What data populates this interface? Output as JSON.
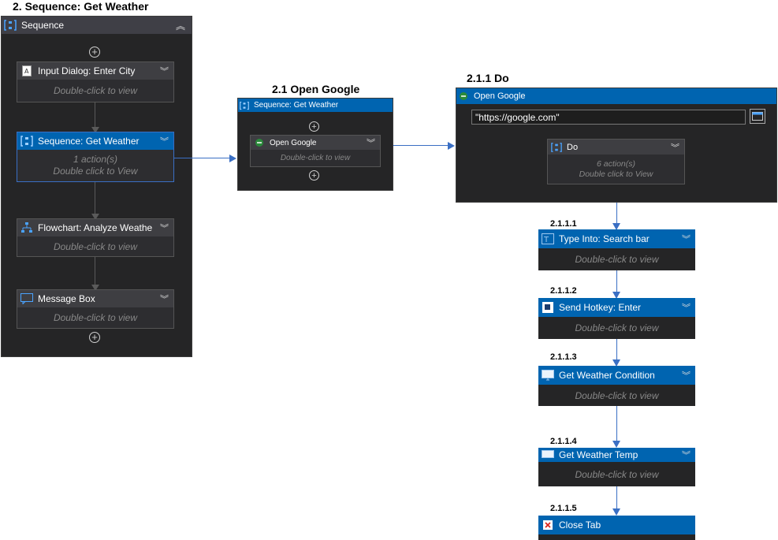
{
  "titles": {
    "main": "2. Sequence: Get Weather",
    "open_google": "2.1 Open Google",
    "do": "2.1.1 Do"
  },
  "main_sequence": {
    "header": "Sequence",
    "activities": [
      {
        "label": "Input Dialog: Enter City",
        "body": "Double-click to view"
      },
      {
        "label": "Sequence: Get Weather",
        "body_line1": "1 action(s)",
        "body_line2": "Double click to View"
      },
      {
        "label": "Flowchart: Analyze Weathe",
        "body": "Double-click to view"
      },
      {
        "label": "Message Box",
        "body": "Double-click to view"
      }
    ]
  },
  "open_google_seq": {
    "header": "Sequence: Get Weather",
    "activity_label": "Open Google",
    "activity_body": "Double-click to view"
  },
  "do_panel": {
    "header": "Open Google",
    "url": "\"https://google.com\"",
    "do_label": "Do",
    "do_line1": "6 action(s)",
    "do_line2": "Double click to View"
  },
  "steps": [
    {
      "number": "2.1.1.1",
      "label": "Type Into: Search bar",
      "body": "Double-click to view"
    },
    {
      "number": "2.1.1.2",
      "label": "Send Hotkey: Enter",
      "body": "Double-click to view"
    },
    {
      "number": "2.1.1.3",
      "label": "Get Weather Condition",
      "body": "Double-click to view"
    },
    {
      "number": "2.1.1.4",
      "label": "Get Weather Temp",
      "body": "Double-click to view"
    },
    {
      "number": "2.1.1.5",
      "label": "Close Tab"
    }
  ],
  "colors": {
    "accent": "#0064b0",
    "connector": "#3a6fc4",
    "panel": "#252526"
  }
}
